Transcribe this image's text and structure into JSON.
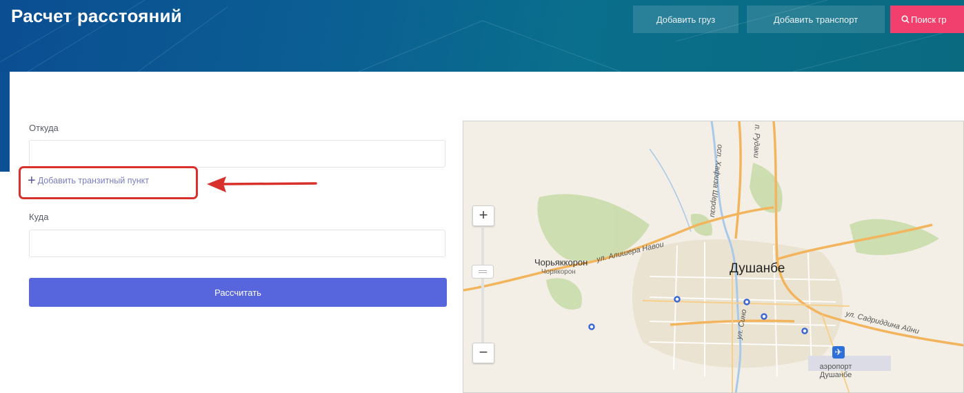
{
  "header": {
    "title": "Расчет расстояний",
    "buttons": {
      "add_cargo": "Добавить груз",
      "add_transport": "Добавить транспорт",
      "search": "Поиск гр"
    }
  },
  "form": {
    "from_label": "Откуда",
    "from_value": "",
    "transit_link": "Добавить транзитный пункт",
    "to_label": "Куда",
    "to_value": "",
    "calculate_button": "Рассчитать"
  },
  "map": {
    "zoom_in": "+",
    "zoom_out": "−",
    "labels": {
      "city": "Душанбе",
      "district": "Чорьяккорон",
      "district_sub": "Чорякорон",
      "street_navoi": "ул. Алишера Навои",
      "street_hafiz": "осп. Хафиза Шерози",
      "street_rudaki": "п. Рудаки",
      "street_sadriddin": "ул. Садриддина Айни",
      "street_sino": "ул. Сино",
      "airport": "аэропорт Душанбе"
    }
  },
  "colors": {
    "header_bg": "#0b5a92",
    "accent_button": "#5866de",
    "search_button": "#f2406e",
    "highlight": "#d8302b"
  },
  "icons": [
    "search-icon",
    "plus-icon",
    "arrow-icon",
    "airport-icon"
  ]
}
